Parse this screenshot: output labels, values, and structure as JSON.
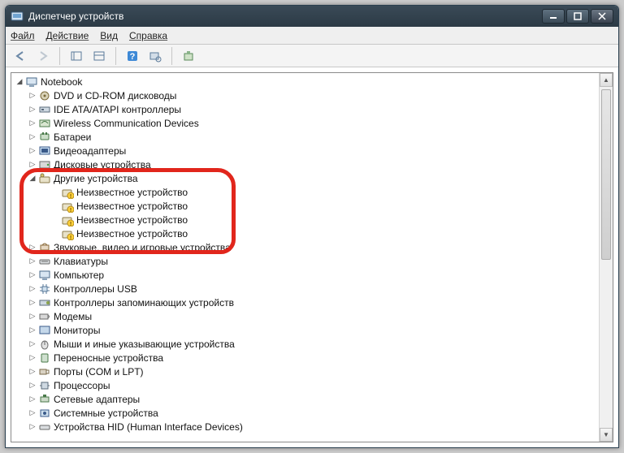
{
  "window": {
    "title": "Диспетчер устройств"
  },
  "menu": {
    "file": "Файл",
    "action": "Действие",
    "view": "Вид",
    "help": "Справка"
  },
  "tree": {
    "root": "Notebook",
    "nodes": [
      {
        "label": "DVD и CD-ROM дисководы"
      },
      {
        "label": "IDE ATA/ATAPI контроллеры"
      },
      {
        "label": "Wireless Communication Devices"
      },
      {
        "label": "Батареи"
      },
      {
        "label": "Видеоадаптеры"
      },
      {
        "label": "Дисковые устройства"
      }
    ],
    "other": {
      "label": "Другие устройства",
      "children_label": "Неизвестное устройство"
    },
    "nodes2": [
      {
        "label": "Звуковые, видео и игровые устройства"
      },
      {
        "label": "Клавиатуры"
      },
      {
        "label": "Компьютер"
      },
      {
        "label": "Контроллеры USB"
      },
      {
        "label": "Контроллеры запоминающих устройств"
      },
      {
        "label": "Модемы"
      },
      {
        "label": "Мониторы"
      },
      {
        "label": "Мыши и иные указывающие устройства"
      },
      {
        "label": "Переносные устройства"
      },
      {
        "label": "Порты (COM и LPT)"
      },
      {
        "label": "Процессоры"
      },
      {
        "label": "Сетевые адаптеры"
      },
      {
        "label": "Системные устройства"
      },
      {
        "label": "Устройства HID (Human Interface Devices)"
      }
    ]
  }
}
